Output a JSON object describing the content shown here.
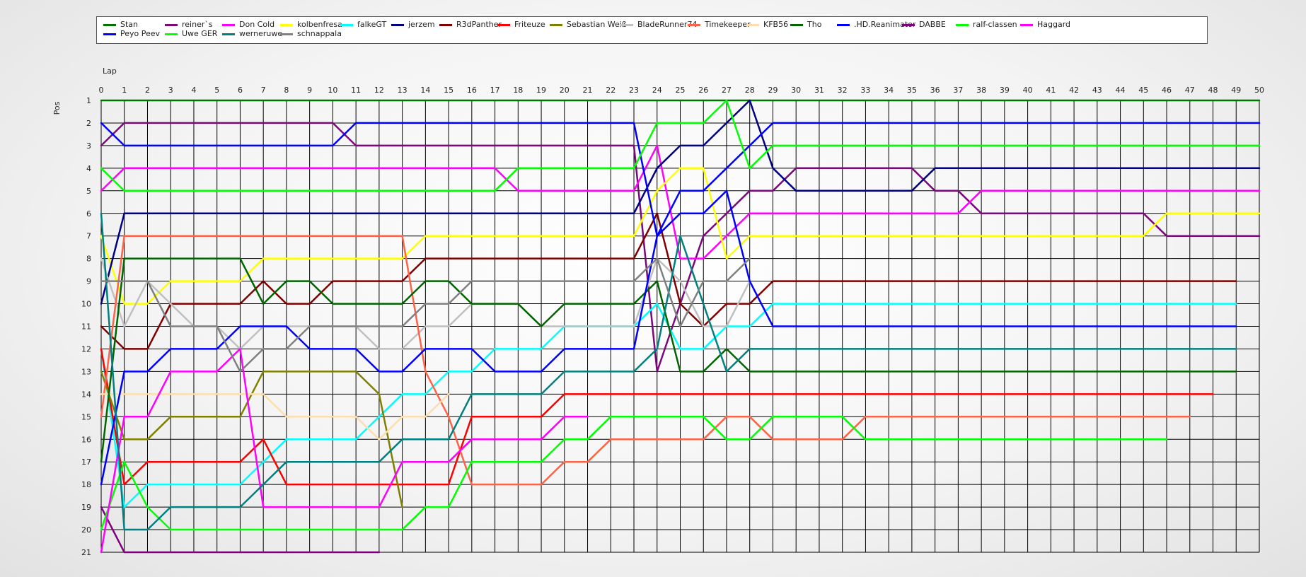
{
  "chart_data": {
    "type": "line",
    "xlabel": "Lap",
    "ylabel": "Pos",
    "xlim": [
      0,
      50
    ],
    "ylim": [
      1,
      21
    ],
    "grid": true,
    "legend_position": "top",
    "x_ticks": [
      0,
      1,
      2,
      3,
      4,
      5,
      6,
      7,
      8,
      9,
      10,
      11,
      12,
      13,
      14,
      15,
      16,
      17,
      18,
      19,
      20,
      21,
      22,
      23,
      24,
      25,
      26,
      27,
      28,
      29,
      30,
      31,
      32,
      33,
      34,
      35,
      36,
      37,
      38,
      39,
      40,
      41,
      42,
      43,
      44,
      45,
      46,
      47,
      48,
      49,
      50
    ],
    "y_ticks": [
      1,
      2,
      3,
      4,
      5,
      6,
      7,
      8,
      9,
      10,
      11,
      12,
      13,
      14,
      15,
      16,
      17,
      18,
      19,
      20,
      21
    ],
    "series": [
      {
        "name": "Stan",
        "color": "#007400",
        "values": [
          1,
          1,
          1,
          1,
          1,
          1,
          1,
          1,
          1,
          1,
          1,
          1,
          1,
          1,
          1,
          1,
          1,
          1,
          1,
          1,
          1,
          1,
          1,
          1,
          1,
          1,
          1,
          1,
          1,
          1,
          1,
          1,
          1,
          1,
          1,
          1,
          1,
          1,
          1,
          1,
          1,
          1,
          1,
          1,
          1,
          1,
          1,
          1,
          1,
          1,
          1
        ]
      },
      {
        "name": "reiner`s",
        "color": "#7a0a7a",
        "values": [
          3,
          2,
          2,
          2,
          2,
          2,
          2,
          2,
          2,
          2,
          2,
          3,
          3,
          3,
          3,
          3,
          3,
          3,
          3,
          3,
          3,
          3,
          3,
          3,
          13,
          10,
          7,
          6,
          5,
          5,
          4,
          4,
          4,
          4,
          4,
          4,
          5,
          5,
          6,
          6,
          6,
          6,
          6,
          6,
          6,
          6,
          7,
          7,
          7,
          7,
          7
        ]
      },
      {
        "name": "Don Cold",
        "color": "#ff00ff",
        "values": [
          5,
          4,
          4,
          4,
          4,
          4,
          4,
          4,
          4,
          4,
          4,
          4,
          4,
          4,
          4,
          4,
          4,
          4,
          5,
          5,
          5,
          5,
          5,
          5,
          3,
          8,
          8,
          7,
          6,
          6,
          6,
          6,
          6,
          6,
          6,
          6,
          6,
          6,
          5,
          5,
          5,
          5,
          5,
          5,
          5,
          5,
          5,
          5,
          5,
          5,
          5
        ]
      },
      {
        "name": "kolbenfresa",
        "color": "#ffff00",
        "values": [
          7,
          10,
          10,
          9,
          9,
          9,
          9,
          8,
          8,
          8,
          8,
          8,
          8,
          8,
          7,
          7,
          7,
          7,
          7,
          7,
          7,
          7,
          7,
          7,
          5,
          4,
          4,
          8,
          7,
          7,
          7,
          7,
          7,
          7,
          7,
          7,
          7,
          7,
          7,
          7,
          7,
          7,
          7,
          7,
          7,
          7,
          6,
          6,
          6,
          6,
          6
        ]
      },
      {
        "name": "falkeGT",
        "color": "#00ffff",
        "values": [
          12,
          19,
          18,
          18,
          18,
          18,
          18,
          17,
          16,
          16,
          16,
          16,
          15,
          14,
          14,
          13,
          13,
          12,
          12,
          12,
          11,
          11,
          11,
          11,
          10,
          12,
          12,
          11,
          11,
          10,
          10,
          10,
          10,
          10,
          10,
          10,
          10,
          10,
          10,
          10,
          10,
          10,
          10,
          10,
          10,
          10,
          10,
          10,
          10,
          10
        ]
      },
      {
        "name": "jerzem",
        "color": "#000080",
        "values": [
          10,
          6,
          6,
          6,
          6,
          6,
          6,
          6,
          6,
          6,
          6,
          6,
          6,
          6,
          6,
          6,
          6,
          6,
          6,
          6,
          6,
          6,
          6,
          6,
          4,
          3,
          3,
          2,
          1,
          4,
          5,
          5,
          5,
          5,
          5,
          5,
          4,
          4,
          4,
          4,
          4,
          4,
          4,
          4,
          4,
          4,
          4,
          4,
          4,
          4,
          4
        ]
      },
      {
        "name": "R3dPanther",
        "color": "#800000",
        "values": [
          11,
          12,
          12,
          10,
          10,
          10,
          10,
          9,
          10,
          10,
          9,
          9,
          9,
          9,
          8,
          8,
          8,
          8,
          8,
          8,
          8,
          8,
          8,
          8,
          6,
          10,
          11,
          10,
          10,
          9,
          9,
          9,
          9,
          9,
          9,
          9,
          9,
          9,
          9,
          9,
          9,
          9,
          9,
          9,
          9,
          9,
          9,
          9,
          9,
          9
        ]
      },
      {
        "name": "Friteuze",
        "color": "#ff0000",
        "values": [
          12,
          18,
          17,
          17,
          17,
          17,
          17,
          16,
          18,
          18,
          18,
          18,
          18,
          18,
          18,
          18,
          15,
          15,
          15,
          15,
          14,
          14,
          14,
          14,
          14,
          14,
          14,
          14,
          14,
          14,
          14,
          14,
          14,
          14,
          14,
          14,
          14,
          14,
          14,
          14,
          14,
          14,
          14,
          14,
          14,
          14,
          14,
          14,
          14
        ]
      },
      {
        "name": "Sebastian Weiß",
        "color": "#808000",
        "values": [
          13,
          16,
          16,
          15,
          15,
          15,
          15,
          13,
          13,
          13,
          13,
          13,
          14,
          19
        ]
      },
      {
        "name": "BladeRunner74",
        "color": "#c0c0c0",
        "values": [
          8,
          11,
          9,
          10,
          11,
          11,
          12,
          11,
          11,
          11,
          11,
          11,
          12,
          12,
          11,
          11,
          10,
          10,
          10,
          11,
          11,
          11,
          11,
          11,
          8,
          9,
          11,
          11,
          9
        ]
      },
      {
        "name": "Timekeeper",
        "color": "#ff6347",
        "values": [
          15,
          7,
          7,
          7,
          7,
          7,
          7,
          7,
          7,
          7,
          7,
          7,
          7,
          7,
          13,
          15,
          18,
          18,
          18,
          18,
          17,
          17,
          16,
          16,
          16,
          16,
          16,
          15,
          15,
          16,
          16,
          16,
          16,
          15,
          15,
          15,
          15,
          15,
          15,
          15,
          15,
          15,
          15,
          15,
          15,
          15,
          15,
          15
        ]
      },
      {
        "name": "KFB56",
        "color": "#ffdead",
        "values": [
          14,
          14,
          14,
          14,
          14,
          14,
          14,
          14,
          15,
          15,
          15,
          15,
          16,
          15,
          15,
          14
        ]
      },
      {
        "name": "Tho",
        "color": "#006400",
        "values": [
          17,
          8,
          8,
          8,
          8,
          8,
          8,
          10,
          9,
          9,
          10,
          10,
          10,
          10,
          9,
          9,
          10,
          10,
          10,
          11,
          10,
          10,
          10,
          10,
          9,
          13,
          13,
          12,
          13,
          13,
          13,
          13,
          13,
          13,
          13,
          13,
          13,
          13,
          13,
          13,
          13,
          13,
          13,
          13,
          13,
          13,
          13,
          13,
          13,
          13
        ]
      },
      {
        "name": ".HD.Reanimator",
        "color": "#0000ff",
        "values": [
          18,
          13,
          13,
          12,
          12,
          12,
          11,
          11,
          11,
          12,
          12,
          12,
          13,
          13,
          12,
          12,
          12,
          13,
          13,
          13,
          12,
          12,
          12,
          12,
          7,
          6,
          6,
          5,
          9,
          11,
          11,
          11,
          11,
          11,
          11,
          11,
          11,
          11,
          11,
          11,
          11,
          11,
          11,
          11,
          11,
          11,
          11,
          11,
          11,
          11
        ]
      },
      {
        "name": "DABBE",
        "color": "#800080",
        "values": [
          19,
          21,
          21,
          21,
          21,
          21,
          21,
          21,
          21,
          21,
          21,
          21,
          21
        ]
      },
      {
        "name": "ralf-classen",
        "color": "#00ff00",
        "values": [
          20,
          17,
          19,
          20,
          20,
          20,
          20,
          20,
          20,
          20,
          20,
          20,
          20,
          20,
          19,
          19,
          17,
          17,
          17,
          17,
          16,
          16,
          15,
          15,
          15,
          15,
          15,
          16,
          16,
          15,
          15,
          15,
          15,
          16,
          16,
          16,
          16,
          16,
          16,
          16,
          16,
          16,
          16,
          16,
          16,
          16,
          16
        ]
      },
      {
        "name": "Haggard",
        "color": "#ff00ff",
        "values": [
          21,
          15,
          15,
          13,
          13,
          13,
          12,
          19,
          19,
          19,
          19,
          19,
          19,
          17,
          17,
          17,
          16,
          16,
          16,
          16,
          15,
          15
        ]
      },
      {
        "name": "Peyo Peev",
        "color": "#0000ff",
        "values": [
          2,
          3,
          3,
          3,
          3,
          3,
          3,
          3,
          3,
          3,
          3,
          2,
          2,
          2,
          2,
          2,
          2,
          2,
          2,
          2,
          2,
          2,
          2,
          2,
          7,
          5,
          5,
          4,
          3,
          2,
          2,
          2,
          2,
          2,
          2,
          2,
          2,
          2,
          2,
          2,
          2,
          2,
          2,
          2,
          2,
          2,
          2,
          2,
          2,
          2,
          2
        ]
      },
      {
        "name": "Uwe GER",
        "color": "#00ff00",
        "values": [
          4,
          5,
          5,
          5,
          5,
          5,
          5,
          5,
          5,
          5,
          5,
          5,
          5,
          5,
          5,
          5,
          5,
          5,
          4,
          4,
          4,
          4,
          4,
          4,
          2,
          2,
          2,
          1,
          4,
          3,
          3,
          3,
          3,
          3,
          3,
          3,
          3,
          3,
          3,
          3,
          3,
          3,
          3,
          3,
          3,
          3,
          3,
          3,
          3,
          3,
          3
        ]
      },
      {
        "name": "werneruwe",
        "color": "#008080",
        "values": [
          6,
          20,
          20,
          19,
          19,
          19,
          19,
          18,
          17,
          17,
          17,
          17,
          17,
          16,
          16,
          16,
          14,
          14,
          14,
          14,
          13,
          13,
          13,
          13,
          12,
          7,
          10,
          13,
          12,
          12,
          12,
          12,
          12,
          12,
          12,
          12,
          12,
          12,
          12,
          12,
          12,
          12,
          12,
          12,
          12,
          12,
          12,
          12,
          12,
          12
        ]
      },
      {
        "name": "schnappala",
        "color": "#808080",
        "values": [
          9,
          9,
          9,
          11,
          11,
          11,
          13,
          12,
          12,
          11,
          11,
          11,
          11,
          11,
          10,
          10,
          9,
          9,
          9,
          9,
          9,
          9,
          9,
          9,
          8,
          11,
          9,
          9,
          8
        ]
      }
    ]
  }
}
